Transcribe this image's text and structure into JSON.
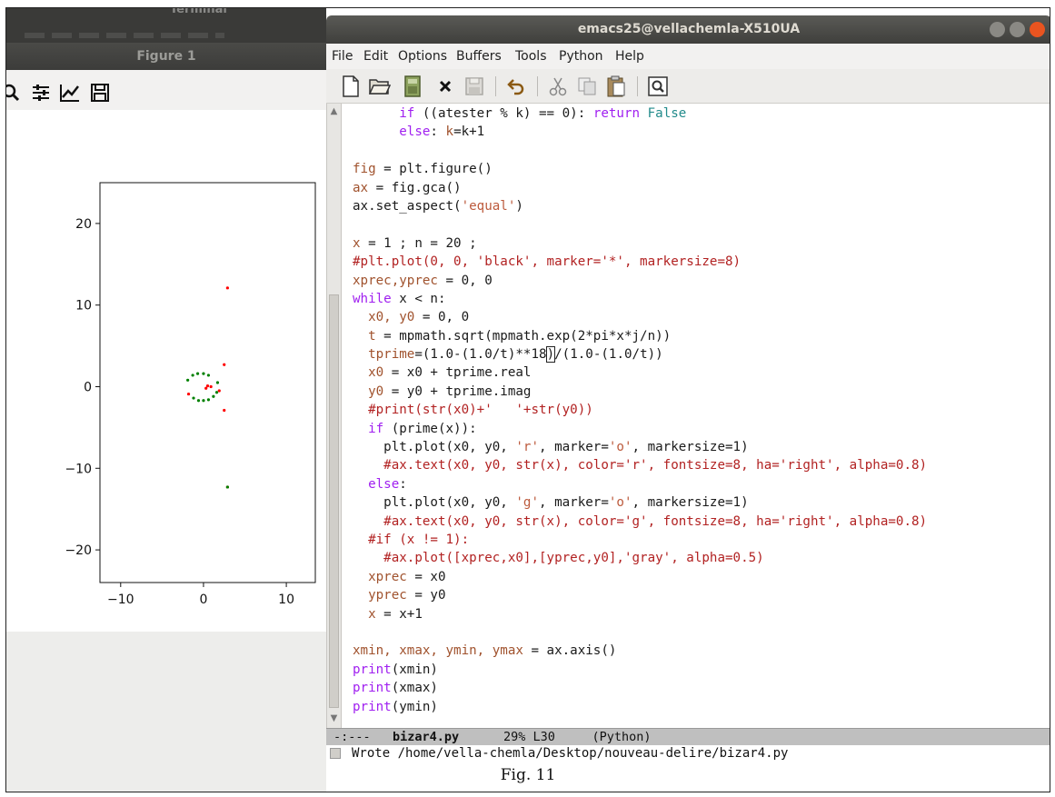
{
  "terminal": {
    "title": "Terminal"
  },
  "figure": {
    "title": "Figure 1",
    "toolbar_icons": [
      "zoom-icon",
      "configure-subplots-icon",
      "edit-axis-icon",
      "save-icon"
    ],
    "chart_data": {
      "type": "scatter",
      "xlim": [
        -12.5,
        13.5
      ],
      "ylim": [
        -24,
        25
      ],
      "xticks": [
        -10,
        0,
        10
      ],
      "yticks": [
        20,
        10,
        0,
        -10,
        -20
      ],
      "xtick_labels": [
        "−10",
        "0",
        "10"
      ],
      "ytick_labels": [
        "20",
        "10",
        "0",
        "−10",
        "−20"
      ],
      "series": [
        {
          "color": "#ff0000",
          "points": [
            [
              2.9,
              12.1
            ],
            [
              2.5,
              2.7
            ],
            [
              2.5,
              -2.9
            ],
            [
              2.9,
              -12.3
            ],
            [
              -1.8,
              -0.9
            ],
            [
              0.5,
              0.1
            ],
            [
              0.9,
              0.0
            ],
            [
              1.9,
              -0.5
            ],
            [
              0.3,
              -0.2
            ]
          ]
        },
        {
          "color": "#008000",
          "points": [
            [
              -1.9,
              0.8
            ],
            [
              -1.3,
              1.4
            ],
            [
              -0.7,
              1.6
            ],
            [
              0.0,
              1.6
            ],
            [
              0.6,
              1.4
            ],
            [
              1.7,
              0.5
            ],
            [
              -1.2,
              -1.4
            ],
            [
              -0.6,
              -1.7
            ],
            [
              0.0,
              -1.7
            ],
            [
              0.6,
              -1.6
            ],
            [
              1.2,
              -1.2
            ],
            [
              1.6,
              -0.7
            ],
            [
              2.9,
              -12.3
            ]
          ]
        }
      ]
    }
  },
  "emacs": {
    "title": "emacs25@vellachemla-X510UA",
    "menu": [
      "File",
      "Edit",
      "Options",
      "Buffers",
      "Tools",
      "Python",
      "Help"
    ],
    "toolbar": [
      "new-file-icon",
      "open-folder-icon",
      "save-buffer-icon",
      "close-buffer-icon",
      "save-disabled-icon",
      "undo-icon",
      "cut-icon",
      "copy-icon",
      "paste-icon",
      "search-icon"
    ],
    "modeline": {
      "status": "-:---",
      "buffer": "bizar4.py",
      "position": "29% L30",
      "mode": "(Python)"
    },
    "minibuffer": "Wrote /home/vella-chemla/Desktop/nouveau-delire/bizar4.py",
    "code_lines": [
      "      if ((atester % k) == 0): return False",
      "      else: k=k+1",
      "",
      "fig = plt.figure()",
      "ax = fig.gca()",
      "ax.set_aspect('equal')",
      "",
      "x = 1 ; n = 20 ;",
      "#plt.plot(0, 0, 'black', marker='*', markersize=8)",
      "xprec,yprec = 0, 0",
      "while x < n:",
      "  x0, y0 = 0, 0",
      "  t = mpmath.sqrt(mpmath.exp(2*pi*x*j/n))",
      "  tprime=(1.0-(1.0/t)**18)/(1.0-(1.0/t))",
      "  x0 = x0 + tprime.real",
      "  y0 = y0 + tprime.imag",
      "  #print(str(x0)+'   '+str(y0))",
      "  if (prime(x)):",
      "    plt.plot(x0, y0, 'r', marker='o', markersize=1)",
      "    #ax.text(x0, y0, str(x), color='r', fontsize=8, ha='right', alpha=0.8)",
      "  else:",
      "    plt.plot(x0, y0, 'g', marker='o', markersize=1)",
      "    #ax.text(x0, y0, str(x), color='g', fontsize=8, ha='right', alpha=0.8)",
      "  #if (x != 1):",
      "    #ax.plot([xprec,x0],[yprec,y0],'gray', alpha=0.5)",
      "  xprec = x0",
      "  yprec = y0",
      "  x = x+1",
      "",
      "xmin, xmax, ymin, ymax = ax.axis()",
      "print(xmin)",
      "print(xmax)",
      "print(ymin)"
    ]
  },
  "caption": "Fig.  11"
}
